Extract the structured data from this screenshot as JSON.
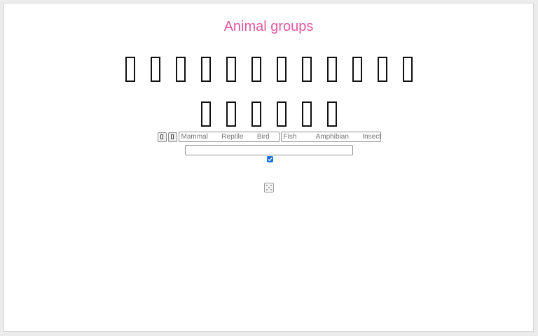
{
  "page": {
    "title": "Animal groups"
  },
  "glyph_rows": [
    {
      "count": 12
    },
    {
      "count": 6
    }
  ],
  "controls": {
    "left_button_icon": "missing-glyph-icon",
    "right_button_icon": "missing-glyph-icon",
    "field_1_placeholder": "Mammal       Reptile       Bird",
    "field_2_placeholder": "Fish          Amphibian       Insect",
    "wide_input_value": "",
    "checkbox_checked": true,
    "dice_icon": "dice-icon"
  },
  "colors": {
    "title": "#e0579f",
    "checkbox": "#1a73e8"
  }
}
